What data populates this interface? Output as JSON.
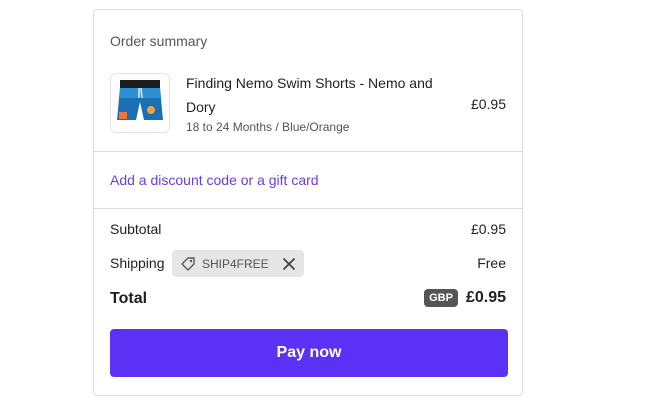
{
  "order_summary": {
    "title": "Order summary",
    "product": {
      "name": "Finding Nemo Swim Shorts - Nemo and Dory",
      "variant": "18 to 24 Months / Blue/Orange",
      "price": "£0.95",
      "image_icon": "swim-shorts-image"
    },
    "discount_link": "Add a discount code or a gift card",
    "subtotal": {
      "label": "Subtotal",
      "value": "£0.95"
    },
    "shipping": {
      "label": "Shipping",
      "value": "Free",
      "code": "SHIP4FREE",
      "tag_icon": "tag-icon",
      "remove_icon": "close-icon"
    },
    "total": {
      "label": "Total",
      "currency": "GBP",
      "value": "£0.95"
    },
    "pay_button": "Pay now"
  },
  "colors": {
    "accent": "#5b31f5",
    "link": "#6a3fe0",
    "tag_bg": "#e6e6e6",
    "badge_bg": "#555555"
  }
}
